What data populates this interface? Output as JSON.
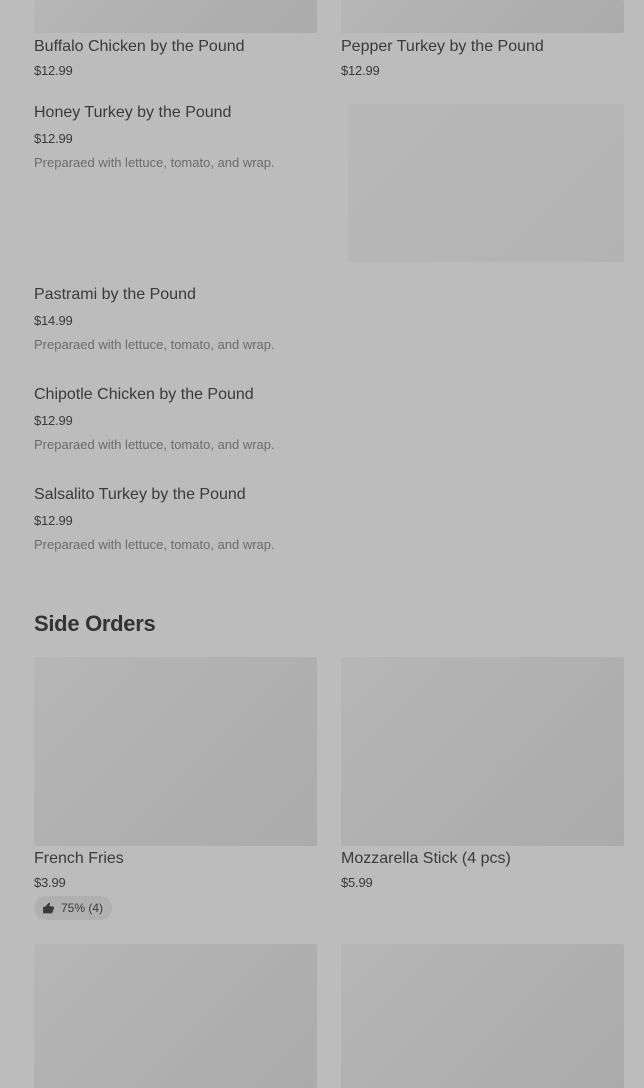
{
  "top_row": [
    {
      "name": "Buffalo Chicken by the Pound",
      "price": "$12.99"
    },
    {
      "name": "Pepper Turkey by the Pound",
      "price": "$12.99"
    }
  ],
  "list_items": [
    {
      "name": "Honey Turkey by the Pound",
      "price": "$12.99",
      "description": "Preparaed with lettuce, tomato, and wrap."
    },
    {
      "name": "Pastrami by the Pound",
      "price": "$14.99",
      "description": "Preparaed with lettuce, tomato, and wrap."
    },
    {
      "name": "Chipotle Chicken by the Pound",
      "price": "$12.99",
      "description": "Preparaed with lettuce, tomato, and wrap."
    },
    {
      "name": "Salsalito Turkey by the Pound",
      "price": "$12.99",
      "description": "Preparaed with lettuce, tomato, and wrap."
    }
  ],
  "side_orders": {
    "title": "Side Orders",
    "items": [
      {
        "name": "French Fries",
        "price": "$3.99",
        "rating": "75% (4)",
        "rating_icon": "thumbs-up-icon"
      },
      {
        "name": "Mozzarella Stick (4 pcs)",
        "price": "$5.99"
      }
    ]
  },
  "colors": {
    "background": "#bcbcbc",
    "placeholder": "#b0b0b0",
    "text": "#3a3a3a",
    "muted_text": "#6b6b6b"
  }
}
